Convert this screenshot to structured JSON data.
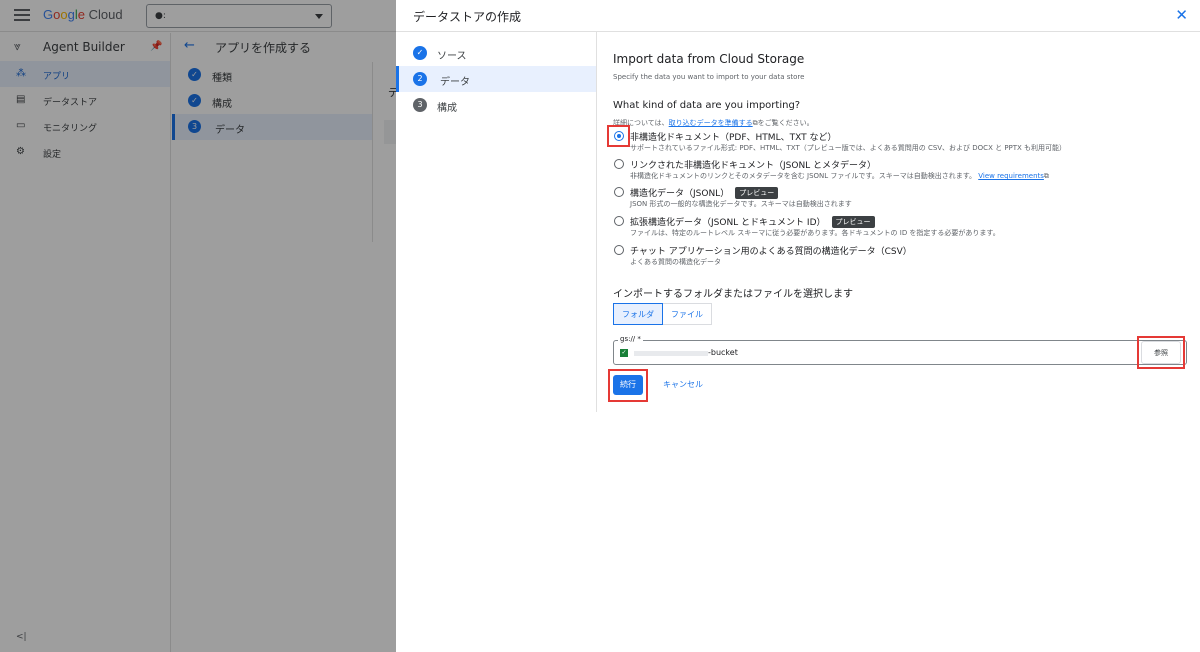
{
  "topbar": {
    "logo_google": [
      "G",
      "o",
      "o",
      "g",
      "l",
      "e"
    ],
    "logo_cloud": "Cloud"
  },
  "sidebar": {
    "title": "Agent Builder",
    "items": [
      {
        "label": "アプリ",
        "icon": "apps-icon",
        "active": true
      },
      {
        "label": "データストア",
        "icon": "datastore-icon",
        "active": false
      },
      {
        "label": "モニタリング",
        "icon": "monitoring-icon",
        "active": false
      },
      {
        "label": "設定",
        "icon": "gear-icon",
        "active": false
      }
    ],
    "collapse": "<|"
  },
  "middle": {
    "title": "アプリを作成する",
    "steps": [
      {
        "num": "✓",
        "label": "種類"
      },
      {
        "num": "✓",
        "label": "構成"
      },
      {
        "num": "3",
        "label": "データ"
      }
    ],
    "peek": "デ"
  },
  "panel": {
    "title": "データストアの作成",
    "steps": [
      {
        "num": "✓",
        "label": "ソース"
      },
      {
        "num": "2",
        "label": "データ"
      },
      {
        "num": "3",
        "label": "構成"
      }
    ],
    "heading": "Import data from Cloud Storage",
    "subheading": "Specify the data you want to import to your data store",
    "question": "What kind of data are you importing?",
    "hint_pre": "詳細については、",
    "hint_link": "取り込むデータを準備する",
    "hint_post": "をご覧ください。",
    "options": [
      {
        "title": "非構造化ドキュメント（PDF、HTML、TXT など）",
        "desc": "サポートされているファイル形式: PDF、HTML、TXT（プレビュー版では、よくある質問用の CSV、および DOCX と PPTX も利用可能）",
        "checked": true
      },
      {
        "title": "リンクされた非構造化ドキュメント（JSONL とメタデータ）",
        "desc": "非構造化ドキュメントのリンクとそのメタデータを含む JSONL ファイルです。スキーマは自動検出されます。",
        "link": "View requirements",
        "checked": false
      },
      {
        "title": "構造化データ（JSONL）",
        "badge": "プレビュー",
        "desc": "JSON 形式の一般的な構造化データです。スキーマは自動検出されます",
        "checked": false
      },
      {
        "title": "拡張構造化データ（JSONL とドキュメント ID）",
        "badge": "プレビュー",
        "desc": "ファイルは、特定のルートレベル スキーマに従う必要があります。各ドキュメントの ID を指定する必要があります。",
        "checked": false
      },
      {
        "title": "チャット アプリケーション用のよくある質問の構造化データ（CSV）",
        "desc": "よくある質問の構造化データ",
        "checked": false
      }
    ],
    "select_title": "インポートするフォルダまたはファイルを選択します",
    "toggle": {
      "folder": "フォルダ",
      "file": "ファイル"
    },
    "gs_label": "gs:// *",
    "gs_value": "-bucket",
    "browse": "参照",
    "continue": "続行",
    "cancel": "キャンセル"
  },
  "colors": {
    "accent": "#1a73e8",
    "highlight": "#e53935",
    "badge": "#3c4043"
  }
}
